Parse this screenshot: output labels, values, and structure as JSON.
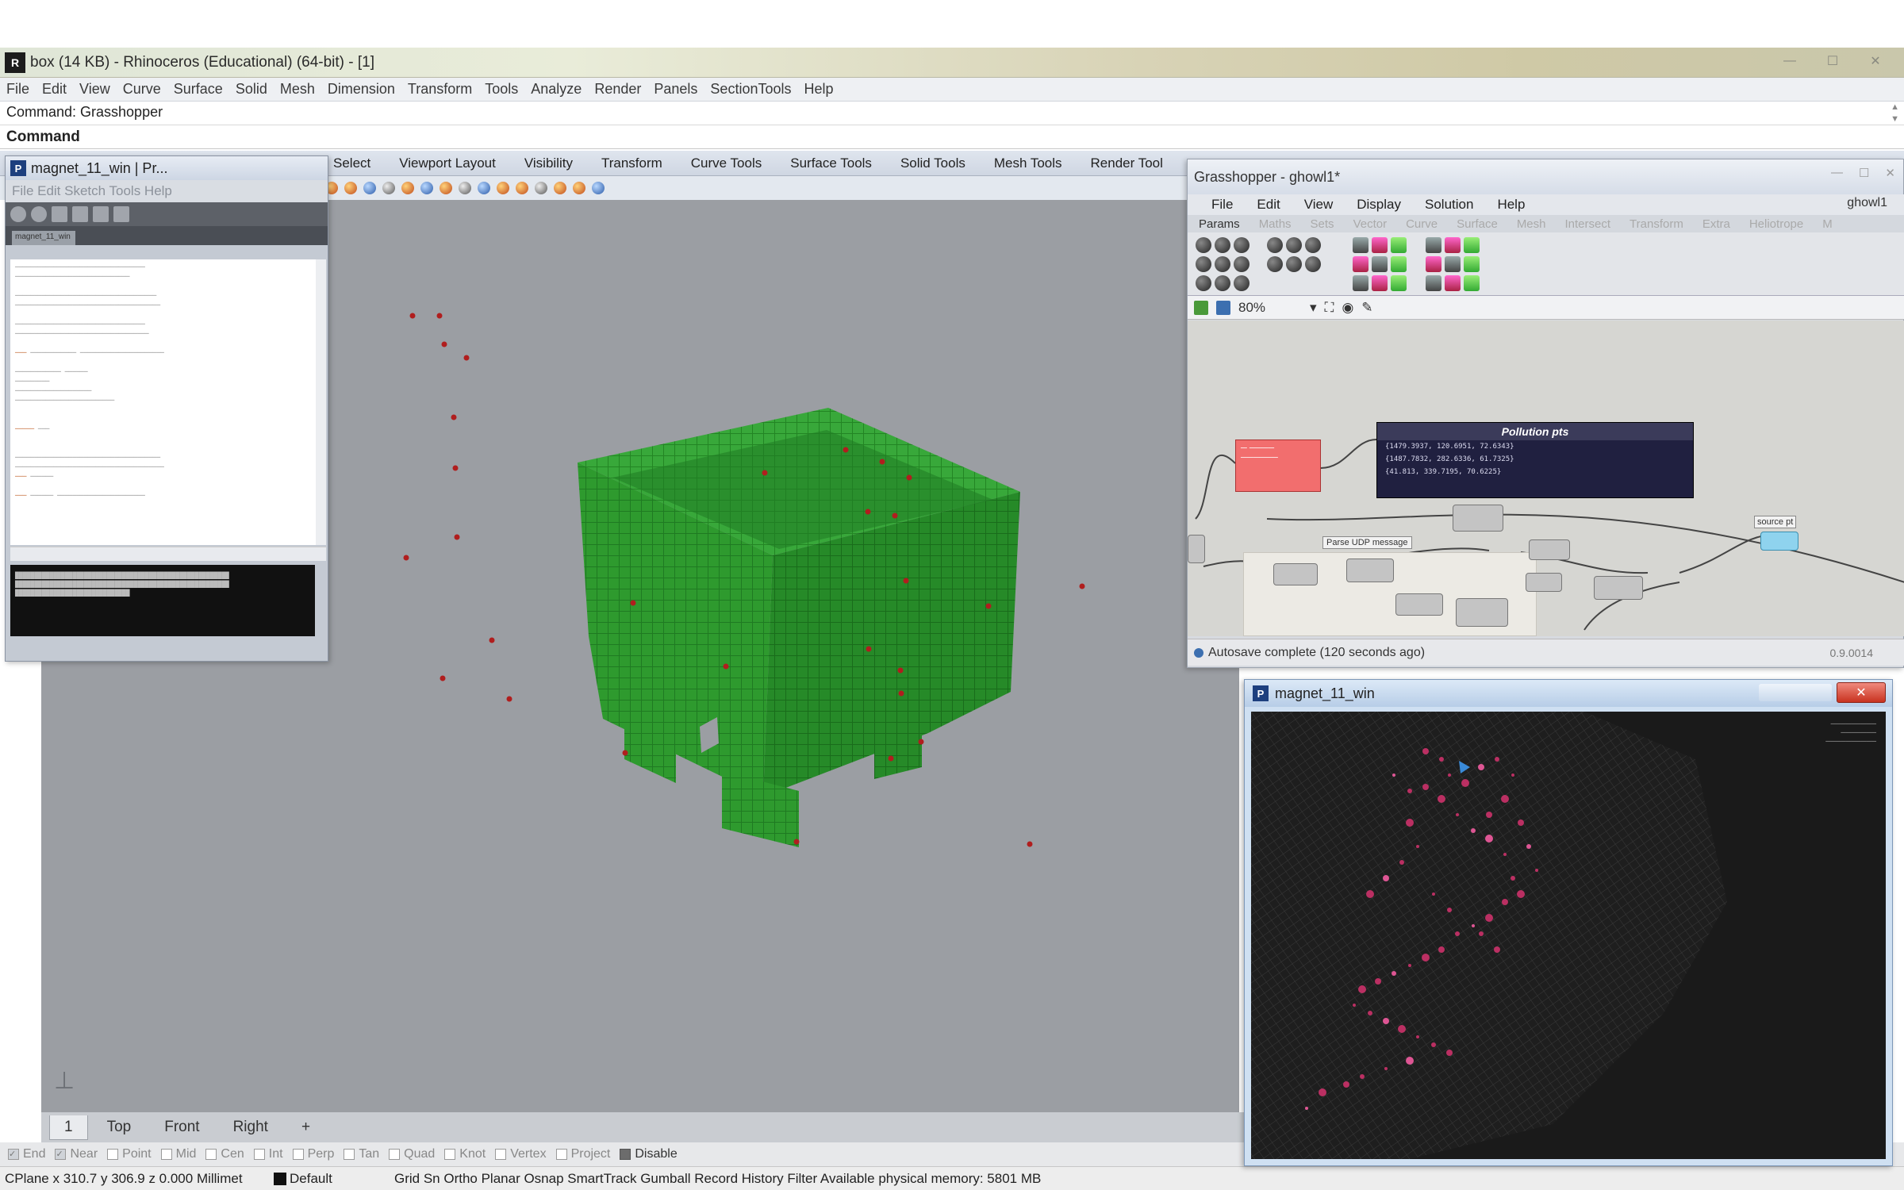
{
  "rhino": {
    "title": "box (14 KB) - Rhinoceros (Educational) (64-bit) - [1]",
    "menu": [
      "File",
      "Edit",
      "View",
      "Curve",
      "Surface",
      "Solid",
      "Mesh",
      "Dimension",
      "Transform",
      "Tools",
      "Analyze",
      "Render",
      "Panels",
      "SectionTools",
      "Help"
    ],
    "command_history": "Command: Grasshopper",
    "command_prompt": "Command",
    "toolbar_tabs": [
      "Select",
      "Viewport Layout",
      "Visibility",
      "Transform",
      "Curve Tools",
      "Surface Tools",
      "Solid Tools",
      "Mesh Tools",
      "Render Tool"
    ],
    "viewport_tabs": [
      "1",
      "Top",
      "Front",
      "Right"
    ],
    "osnaps": [
      {
        "label": "End",
        "checked": true
      },
      {
        "label": "Near",
        "checked": true
      },
      {
        "label": "Point",
        "checked": false
      },
      {
        "label": "Mid",
        "checked": false
      },
      {
        "label": "Cen",
        "checked": false
      },
      {
        "label": "Int",
        "checked": false
      },
      {
        "label": "Perp",
        "checked": false
      },
      {
        "label": "Tan",
        "checked": false
      },
      {
        "label": "Quad",
        "checked": false
      },
      {
        "label": "Knot",
        "checked": false
      },
      {
        "label": "Vertex",
        "checked": false
      },
      {
        "label": "Project",
        "checked": false
      },
      {
        "label": "Disable",
        "checked": true
      }
    ],
    "status": {
      "coords": "CPlane x 310.7 y 306.9 z 0.000 Millimet",
      "layer": "Default",
      "modes": "Grid Sn Ortho Planar Osnap SmartTrack Gumball Record History Filter Available physical memory: 5801 MB"
    },
    "model_color": "#2e9a2e",
    "point_color": "#b01e1e",
    "viewport_color": "#9b9ea3"
  },
  "processing": {
    "title": "magnet_11_win | Pr...",
    "menu": "File Edit Sketch Tools Help",
    "tab": "magnet_11_win"
  },
  "grasshopper": {
    "title": "Grasshopper - ghowl1*",
    "doc_name": "ghowl1",
    "menu": [
      "File",
      "Edit",
      "View",
      "Display",
      "Solution",
      "Help"
    ],
    "tabs": [
      "Params",
      "Maths",
      "Sets",
      "Vector",
      "Curve",
      "Surface",
      "Mesh",
      "Intersect",
      "Transform",
      "Extra",
      "Heliotrope",
      "M"
    ],
    "zoom": "80%",
    "panel_title": "Pollution pts",
    "panel_lines": [
      "{1479.3937, 120.6951, 72.6343}",
      "{1487.7832, 282.6336, 61.7325}",
      "{41.813, 339.7195, 70.6225}"
    ],
    "udp_label": "Parse UDP message",
    "source_label": "source pt",
    "status": "Autosave complete (120 seconds ago)",
    "version": "0.9.0014"
  },
  "magnet": {
    "title": "magnet_11_win",
    "close_label": "✕"
  }
}
